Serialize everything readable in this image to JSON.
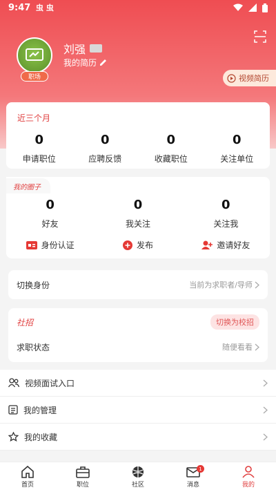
{
  "status_bar": {
    "time": "9:47"
  },
  "profile": {
    "name": "刘强",
    "resume_link": "我的简历",
    "badge": "职场",
    "video_resume": "视频简历"
  },
  "recent": {
    "title": "近三个月",
    "stats": [
      {
        "value": "0",
        "label": "申请职位"
      },
      {
        "value": "0",
        "label": "应聘反馈"
      },
      {
        "value": "0",
        "label": "收藏职位"
      },
      {
        "value": "0",
        "label": "关注单位"
      }
    ]
  },
  "circle": {
    "title": "我的圈子",
    "stats": [
      {
        "value": "0",
        "label": "好友"
      },
      {
        "value": "0",
        "label": "我关注"
      },
      {
        "value": "0",
        "label": "关注我"
      }
    ],
    "actions": [
      {
        "label": "身份认证",
        "icon": "id-card-icon"
      },
      {
        "label": "发布",
        "icon": "plus-circle-icon"
      },
      {
        "label": "邀请好友",
        "icon": "add-user-icon"
      }
    ]
  },
  "switch_identity": {
    "label": "切换身份",
    "value": "当前为求职者/导师"
  },
  "social": {
    "title": "社招",
    "switch_button": "切换为校招",
    "status_label": "求职状态",
    "status_value": "随便看看"
  },
  "menu": [
    {
      "label": "视频面试入口",
      "icon": "people-icon"
    },
    {
      "label": "我的管理",
      "icon": "document-icon"
    },
    {
      "label": "我的收藏",
      "icon": "star-icon"
    }
  ],
  "nav": {
    "items": [
      {
        "label": "首页",
        "icon": "home-icon"
      },
      {
        "label": "职位",
        "icon": "briefcase-icon"
      },
      {
        "label": "社区",
        "icon": "globe-icon"
      },
      {
        "label": "消息",
        "icon": "mail-icon",
        "badge": "1"
      },
      {
        "label": "我的",
        "icon": "person-icon"
      }
    ],
    "active_color": "#e03d3d"
  },
  "colors": {
    "accent": "#ef4d52",
    "accent_text": "#e03d3d"
  }
}
